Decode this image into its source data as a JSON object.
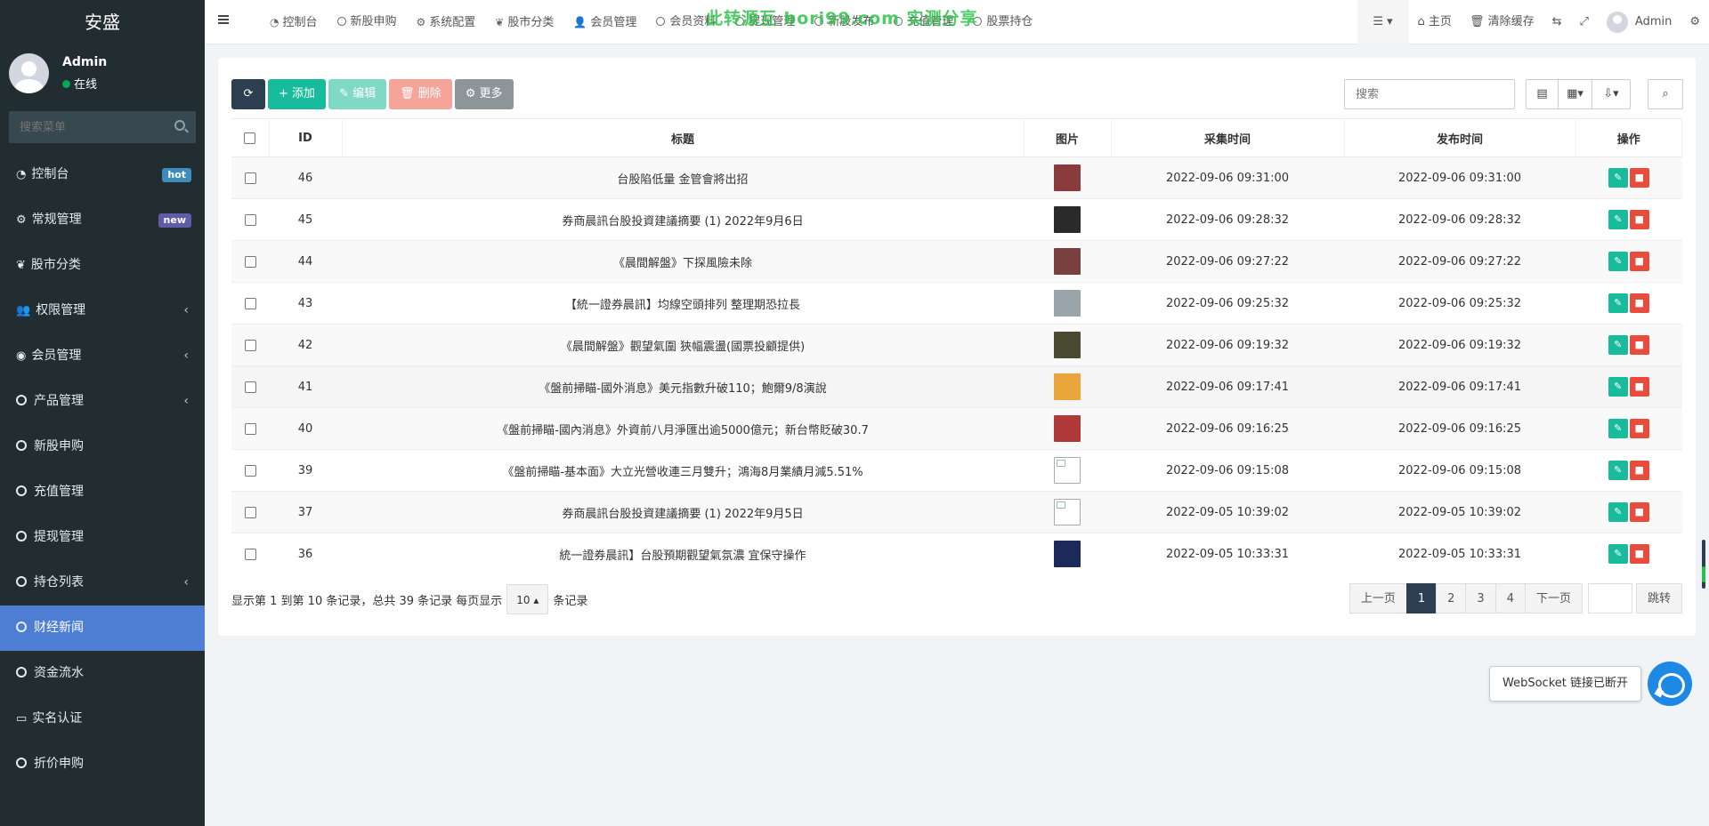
{
  "app": {
    "logo": "安盛",
    "watermark": "此转源互 bori99.com 实测分享"
  },
  "user": {
    "name": "Admin",
    "status": "在线"
  },
  "sidebar": {
    "search_placeholder": "搜索菜单",
    "items": [
      {
        "label": "控制台",
        "badge": "hot",
        "icon": "dashboard-icon"
      },
      {
        "label": "常规管理",
        "badge": "new",
        "icon": "cogs-icon"
      },
      {
        "label": "股市分类",
        "icon": "leaf-icon"
      },
      {
        "label": "权限管理",
        "chevron": "‹",
        "icon": "group-icon"
      },
      {
        "label": "会员管理",
        "chevron": "‹",
        "icon": "user-circle-icon"
      },
      {
        "label": "产品管理",
        "chevron": "‹",
        "icon": "circle-icon"
      },
      {
        "label": "新股申购",
        "icon": "circle-icon"
      },
      {
        "label": "充值管理",
        "icon": "circle-icon"
      },
      {
        "label": "提现管理",
        "icon": "circle-icon"
      },
      {
        "label": "持仓列表",
        "chevron": "‹",
        "icon": "circle-icon"
      },
      {
        "label": "财经新闻",
        "active": true,
        "icon": "circle-icon"
      },
      {
        "label": "资金流水",
        "icon": "circle-icon"
      },
      {
        "label": "实名认证",
        "icon": "credit-card-icon"
      },
      {
        "label": "折价申购",
        "icon": "circle-icon"
      }
    ]
  },
  "topnav": {
    "items": [
      "控制台",
      "新股申购",
      "系统配置",
      "股市分类",
      "会员管理",
      "会员资料",
      "提现管理",
      "新股发布",
      "充值管理",
      "股票持仓"
    ],
    "right": {
      "home": "主页",
      "clear_cache": "清除缓存",
      "user": "Admin"
    }
  },
  "toolbar": {
    "add": "添加",
    "edit": "编辑",
    "delete": "删除",
    "more": "更多",
    "search_placeholder": "搜索"
  },
  "table": {
    "headers": [
      "ID",
      "标题",
      "图片",
      "采集时间",
      "发布时间",
      "操作"
    ],
    "rows": [
      {
        "id": "46",
        "title": "台股陷低量 金管會將出招",
        "collect": "2022-09-06 09:31:00",
        "publish": "2022-09-06 09:31:00",
        "thumb": "#8a3b3b"
      },
      {
        "id": "45",
        "title": "券商晨訊台股投資建議摘要 (1) 2022年9月6日",
        "collect": "2022-09-06 09:28:32",
        "publish": "2022-09-06 09:28:32",
        "thumb": "#2a2a2a"
      },
      {
        "id": "44",
        "title": "《晨間解盤》下探風險未除",
        "collect": "2022-09-06 09:27:22",
        "publish": "2022-09-06 09:27:22",
        "thumb": "#7a4040"
      },
      {
        "id": "43",
        "title": "【統一證券晨訊】均線空頭排列 整理期恐拉長",
        "collect": "2022-09-06 09:25:32",
        "publish": "2022-09-06 09:25:32",
        "thumb": "#9aa4ab"
      },
      {
        "id": "42",
        "title": "《晨間解盤》觀望氣圍 狹幅震盪(國票投顧提供)",
        "collect": "2022-09-06 09:19:32",
        "publish": "2022-09-06 09:19:32",
        "thumb": "#4a4a30"
      },
      {
        "id": "41",
        "title": "《盤前掃瞄-國外消息》美元指數升破110；鮑爾9/8演說",
        "collect": "2022-09-06 09:17:41",
        "publish": "2022-09-06 09:17:41",
        "thumb": "#e8a53a"
      },
      {
        "id": "40",
        "title": "《盤前掃瞄-國內消息》外資前八月淨匯出逾5000億元；新台幣貶破30.7",
        "collect": "2022-09-06 09:16:25",
        "publish": "2022-09-06 09:16:25",
        "thumb": "#b03a3a"
      },
      {
        "id": "39",
        "title": "《盤前掃瞄-基本面》大立光營收連三月雙升；鴻海8月業績月減5.51%",
        "collect": "2022-09-06 09:15:08",
        "publish": "2022-09-06 09:15:08",
        "thumb": "broken"
      },
      {
        "id": "37",
        "title": "券商晨訊台股投資建議摘要 (1) 2022年9月5日",
        "collect": "2022-09-05 10:39:02",
        "publish": "2022-09-05 10:39:02",
        "thumb": "broken"
      },
      {
        "id": "36",
        "title": "統一證券晨訊】台股預期觀望氣氛濃 宜保守操作",
        "collect": "2022-09-05 10:33:31",
        "publish": "2022-09-05 10:33:31",
        "thumb": "#1c2a5a"
      }
    ]
  },
  "footer": {
    "summary": "显示第 1 到第 10 条记录，总共 39 条记录 每页显示",
    "page_size": "10",
    "suffix": "条记录",
    "prev": "上一页",
    "next": "下一页",
    "pages": [
      "1",
      "2",
      "3",
      "4"
    ],
    "current_page": "1",
    "jump": "跳转"
  },
  "websocket": {
    "status": "WebSocket 链接已断开"
  },
  "colors": {
    "sidebar_bg": "#222d32",
    "active": "#4e7dd4",
    "primary": "#18bc9c",
    "danger": "#e74c3c",
    "dark": "#2c3e50"
  }
}
